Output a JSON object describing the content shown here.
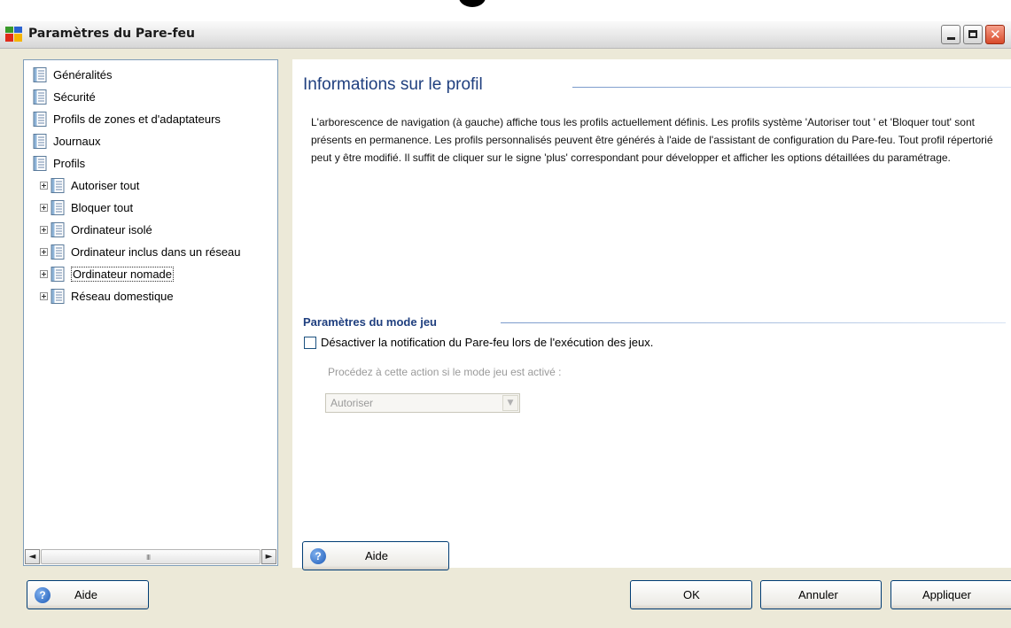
{
  "window": {
    "title": "Paramètres du Pare-feu"
  },
  "tree": {
    "items": [
      {
        "label": "Généralités"
      },
      {
        "label": "Sécurité"
      },
      {
        "label": "Profils de zones et d'adaptateurs"
      },
      {
        "label": "Journaux"
      },
      {
        "label": "Profils"
      },
      {
        "label": "Autoriser tout"
      },
      {
        "label": "Bloquer tout"
      },
      {
        "label": "Ordinateur isolé"
      },
      {
        "label": "Ordinateur inclus dans un réseau"
      },
      {
        "label": "Ordinateur nomade",
        "selected": true
      },
      {
        "label": "Réseau domestique"
      }
    ],
    "scroll_grip": "III"
  },
  "content": {
    "section_title": "Informations sur le profil",
    "description": "L'arborescence de navigation (à gauche) affiche tous les profils actuellement définis. Les profils système 'Autoriser tout ' et 'Bloquer tout' sont présents en permanence. Les profils personnalisés peuvent être générés à l'aide de l'assistant de configuration du Pare-feu. Tout profil répertorié peut y être modifié. Il suffit de cliquer sur le signe 'plus' correspondant pour développer et afficher les options détaillées du paramétrage.",
    "game_mode": {
      "title": "Paramètres du mode jeu",
      "checkbox_label": "Désactiver la notification du Pare-feu lors de l'exécution des jeux.",
      "checked": false,
      "action_label": "Procédez à cette action si le mode jeu est activé :",
      "select_value": "Autoriser"
    },
    "help_button": "Aide"
  },
  "footer": {
    "help": "Aide",
    "ok": "OK",
    "cancel": "Annuler",
    "apply": "Appliquer"
  },
  "icons": {
    "help": "?",
    "scroll_left": "◄",
    "scroll_right": "►",
    "select_arrow": "▼",
    "close": "✕"
  },
  "colors": {
    "heading": "#1f3f7f",
    "window_bg": "#ece9d8",
    "button_border": "#003c74"
  }
}
